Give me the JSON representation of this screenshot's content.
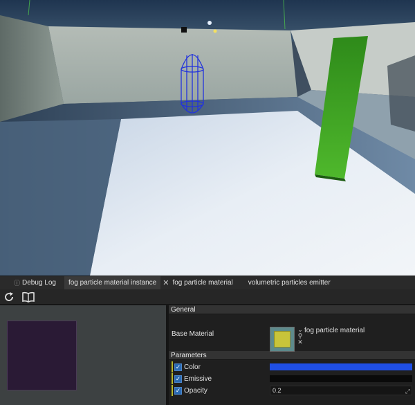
{
  "tabs": [
    {
      "label": "Debug Log",
      "icon": "info-circle-icon",
      "active": false,
      "closable": false
    },
    {
      "label": "fog particle material instance",
      "icon": "",
      "active": true,
      "closable": true
    },
    {
      "label": "fog particle material",
      "icon": "",
      "active": false,
      "closable": false
    },
    {
      "label": "volumetric particles emitter",
      "icon": "",
      "active": false,
      "closable": false
    }
  ],
  "toolbar": {
    "reload_icon": "reload-icon",
    "docs_icon": "open-book-icon"
  },
  "preview": {
    "swatch_color": "#2a1a35"
  },
  "properties": {
    "general_header": "General",
    "base_material_label": "Base Material",
    "base_material_value": "fog particle material",
    "base_material_thumb_color": "#c8c43a",
    "parameters_header": "Parameters",
    "params": {
      "color": {
        "label": "Color",
        "enabled": true,
        "value_color": "#1f4fe6"
      },
      "emissive": {
        "label": "Emissive",
        "enabled": true,
        "value_color": "#0a0a0a"
      },
      "opacity": {
        "label": "Opacity",
        "enabled": true,
        "value": "0.2"
      }
    }
  },
  "colors": {
    "accent_checkbox": "#2b6cb5",
    "selection_wireframe": "#2233dd",
    "green_block": "#3a9a22"
  }
}
